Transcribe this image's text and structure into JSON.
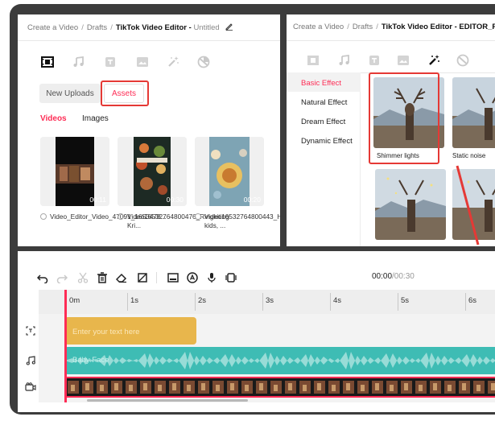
{
  "panel_a": {
    "breadcrumb": {
      "item1": "Create a Video",
      "sep": "/",
      "item2": "Drafts",
      "current": "TikTok Video Editor -",
      "suffix": "Untitled"
    },
    "tool_icons": [
      "video-icon",
      "music-icon",
      "text-icon",
      "sticker-icon",
      "effects-icon",
      "filter-icon"
    ],
    "buttons": {
      "new_uploads": "New Uploads",
      "assets": "Assets"
    },
    "subtabs": {
      "videos": "Videos",
      "images": "Images"
    },
    "thumbs": [
      {
        "duration": "00:11",
        "caption": "Video_Editor_Video_47091_1653478..."
      },
      {
        "duration": "00:30",
        "caption": "Video16532764800476_Ringkiting Kri..."
      },
      {
        "duration": "00:20",
        "caption": "Video16532764800443_Happy, kids, ..."
      }
    ]
  },
  "panel_b": {
    "breadcrumb": {
      "item1": "Create a Video",
      "sep": "/",
      "item2": "Drafts",
      "current": "TikTok Video Editor - EDITOR_PRO"
    },
    "effects_categories": [
      "Basic Effect",
      "Natural Effect",
      "Dream Effect",
      "Dynamic Effect"
    ],
    "effect_cards": [
      "Shimmer lights",
      "Static noise"
    ]
  },
  "timeline": {
    "time_current": "00:00",
    "time_total": "/00:30",
    "ticks": [
      "0m",
      "1s",
      "2s",
      "3s",
      "4s",
      "5s",
      "6s"
    ],
    "text_clip_label": "Enter your text here",
    "audio_clip_label": "Baby Face"
  },
  "colors": {
    "accent": "#fe2c55",
    "highlight": "#e53935",
    "text_clip": "#e8b64c",
    "audio_clip": "#3ebcb4",
    "device_frame": "#3c3c3c"
  }
}
